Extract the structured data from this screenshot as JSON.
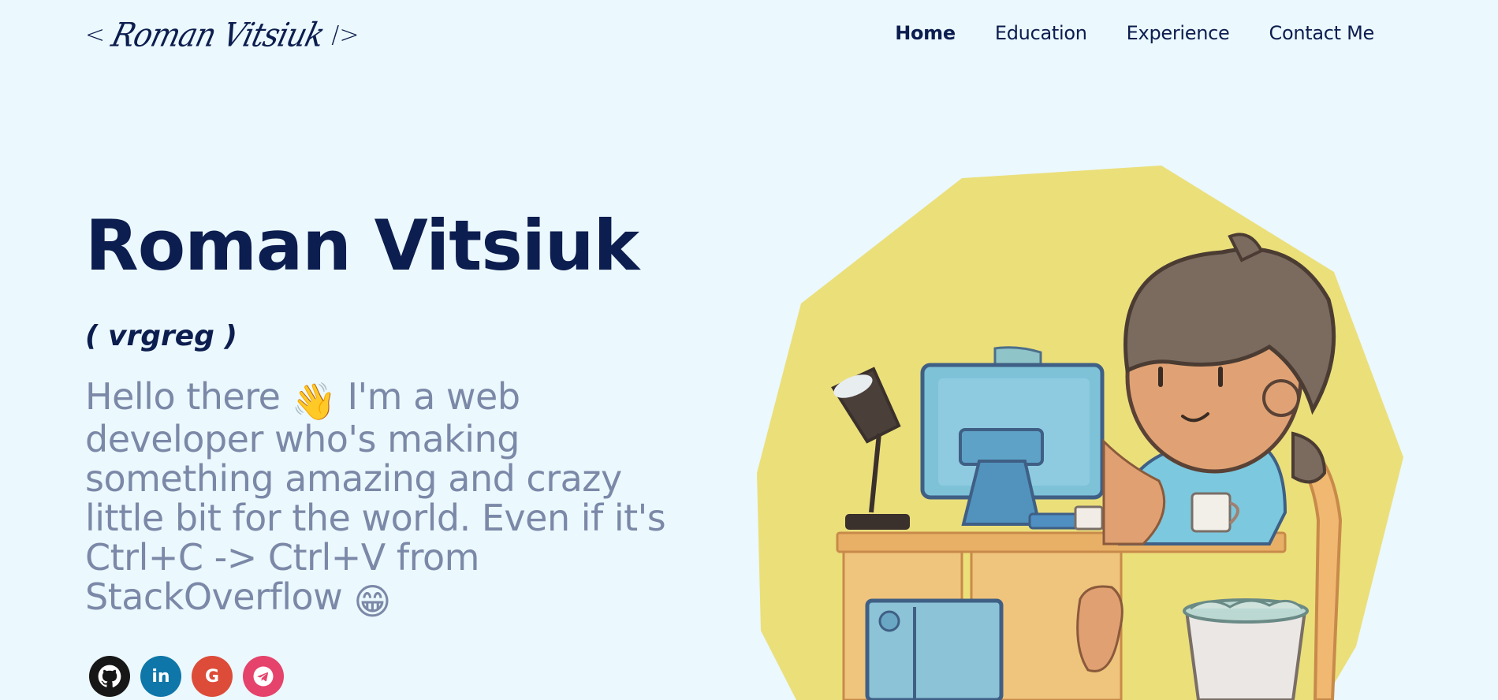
{
  "header": {
    "logo": {
      "open": "<",
      "signature": "Roman Vitsiuk",
      "close": "/>"
    },
    "nav": [
      {
        "label": "Home",
        "active": true
      },
      {
        "label": "Education",
        "active": false
      },
      {
        "label": "Experience",
        "active": false
      },
      {
        "label": "Contact Me",
        "active": false
      }
    ]
  },
  "hero": {
    "name": "Roman Vitsiuk",
    "nickname": "( vrgreg )",
    "greeting": {
      "part1": "Hello there",
      "wave_emoji": "👋",
      "part2": "I'm a web developer who's making something amazing and crazy little bit for the world. Even if it's Ctrl+C -> Ctrl+V from StackOverflow",
      "grin_emoji": "😁"
    }
  },
  "socials": [
    {
      "icon": "github-icon",
      "glyph": "",
      "color": "#181717"
    },
    {
      "icon": "linkedin-icon",
      "glyph": "in",
      "color": "#0e76a8"
    },
    {
      "icon": "google-icon",
      "glyph": "G",
      "color": "#dd4b39"
    },
    {
      "icon": "telegram-icon",
      "glyph": "",
      "color": "#e5436c"
    }
  ],
  "colors": {
    "background": "#ebf8fd",
    "primary_text": "#0c1d4f",
    "secondary_text": "#7b88a7",
    "blob": "#ebdf7a"
  }
}
